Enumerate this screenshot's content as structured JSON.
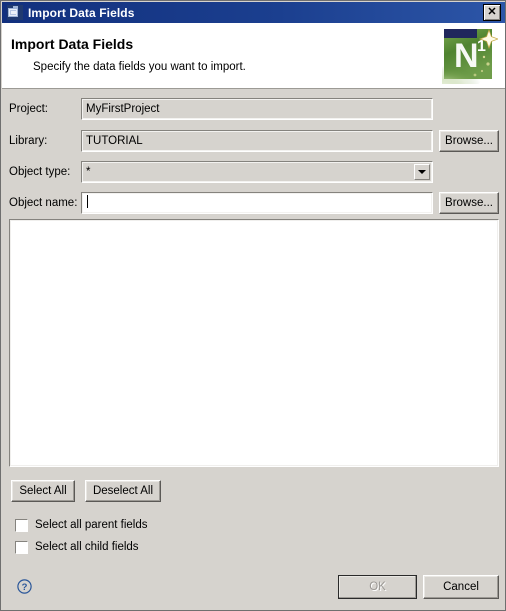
{
  "window": {
    "title": "Import Data Fields",
    "icon": "import-window-icon",
    "close_label": "✕"
  },
  "header": {
    "title": "Import Data Fields",
    "subtitle": "Specify the data fields you want to import.",
    "logo_letter": "N",
    "logo_sup": "1",
    "logo_name": "natural-one-logo"
  },
  "form": {
    "fields": [
      {
        "label": "Project:",
        "value": "MyFirstProject",
        "kind": "readonly",
        "name": "project"
      },
      {
        "label": "Library:",
        "value": "TUTORIAL",
        "kind": "readonly",
        "name": "library"
      },
      {
        "label": "Object type:",
        "value": "*",
        "kind": "combo",
        "name": "object-type"
      },
      {
        "label": "Object name:",
        "value": "",
        "kind": "editable",
        "name": "object-name"
      }
    ],
    "browse_library_label": "Browse...",
    "browse_object_label": "Browse..."
  },
  "list": {
    "items": [],
    "select_all_label": "Select All",
    "deselect_all_label": "Deselect All"
  },
  "options": [
    {
      "label": "Select all parent fields",
      "checked": false,
      "name": "select-all-parent-fields"
    },
    {
      "label": "Select all child fields",
      "checked": false,
      "name": "select-all-child-fields"
    }
  ],
  "footer": {
    "help_label": "?",
    "ok_label": "OK",
    "cancel_label": "Cancel",
    "ok_enabled": false
  },
  "colors": {
    "titlebar_start": "#12307e",
    "titlebar_end": "#2d56a8",
    "dialog_face": "#d6d3ce",
    "logo_green": "#5b8f37",
    "help_blue": "#2a5699"
  }
}
